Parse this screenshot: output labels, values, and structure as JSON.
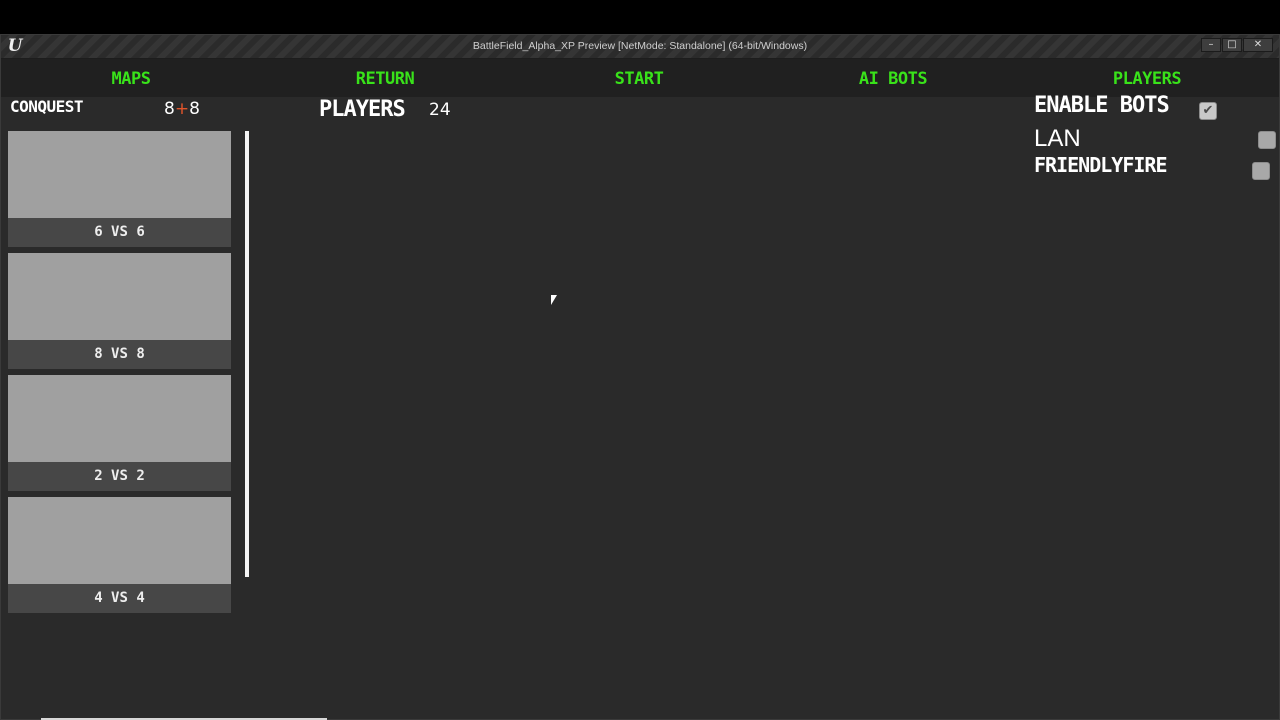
{
  "window": {
    "title": "BattleField_Alpha_XP Preview [NetMode: Standalone]  (64-bit/Windows)",
    "logo": "U",
    "controls": {
      "minimize": "–",
      "maximize": "□",
      "close": "✕"
    }
  },
  "nav": {
    "maps": "MAPS",
    "return": "RETURN",
    "start": "START",
    "ai_bots": "AI BOTS",
    "players": "PLAYERS"
  },
  "mode": {
    "name": "CONQUEST",
    "count_a": "8",
    "plus": "+",
    "count_b": "8"
  },
  "maps": [
    {
      "label": "6 VS 6"
    },
    {
      "label": "8 VS 8"
    },
    {
      "label": "2 VS 2"
    },
    {
      "label": "4 VS 4"
    }
  ],
  "players": {
    "label": "PLAYERS",
    "count": "24"
  },
  "options": {
    "enable_bots": {
      "label": "ENABLE BOTS",
      "checked": true,
      "mark": "✔"
    },
    "lan": {
      "label": "LAN",
      "checked": false
    },
    "friendly_fire": {
      "label": "FRIENDLYFIRE",
      "checked": false
    }
  },
  "colors": {
    "accent_green": "#39e21a",
    "plus_orange": "#e2552a",
    "background": "#2a2a2a"
  }
}
